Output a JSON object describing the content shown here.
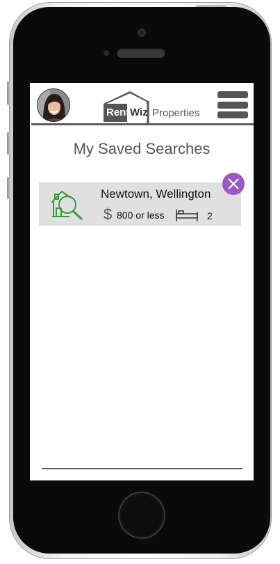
{
  "header": {
    "logo": {
      "rent": "Rent",
      "wiz": "Wiz",
      "properties": "Properties"
    }
  },
  "page": {
    "title": "My Saved Searches"
  },
  "saved_searches": [
    {
      "location": "Newtown, Wellington",
      "currency_symbol": "$",
      "price": "800 or less",
      "bedrooms": "2"
    }
  ],
  "colors": {
    "close_button": "#9b59c6",
    "icon_green": "#3a9a3a",
    "card_background": "#e0e0e0",
    "header_line": "#5c5c5c"
  },
  "icons": {
    "card": "house-search-icon",
    "bedroom": "bed-icon",
    "close": "close-icon",
    "menu": "hamburger-menu-icon"
  }
}
